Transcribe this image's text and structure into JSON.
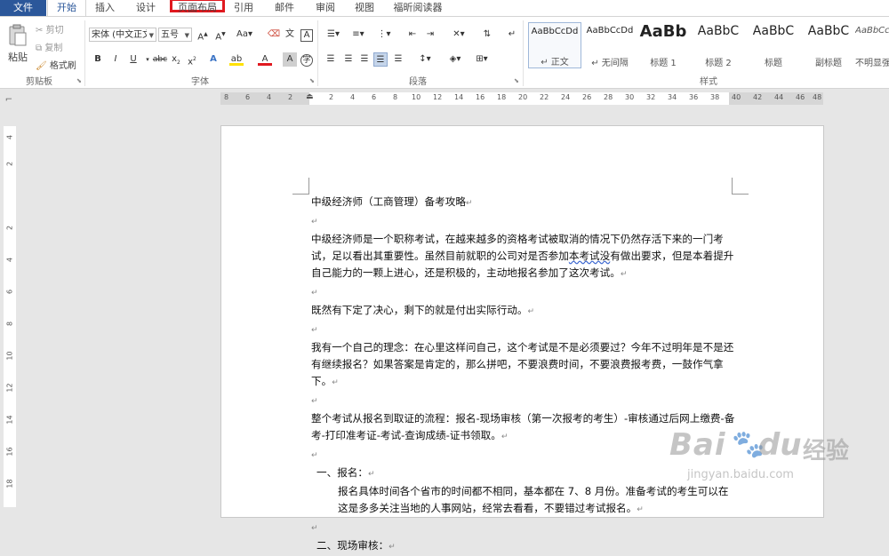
{
  "tabs": {
    "file": "文件",
    "home": "开始",
    "insert": "插入",
    "design": "设计",
    "layout": "页面布局",
    "references": "引用",
    "mailings": "邮件",
    "review": "审阅",
    "view": "视图",
    "foxit": "福昕阅读器"
  },
  "highlight_color": "#e0191f",
  "clipboard": {
    "paste": "粘贴",
    "cut": "剪切",
    "copy": "复制",
    "format_painter": "格式刷",
    "label": "剪贴板"
  },
  "font": {
    "name": "宋体 (中文正文)",
    "size": "五号",
    "label": "字体"
  },
  "paragraph": {
    "label": "段落"
  },
  "styles": {
    "label": "样式",
    "items": [
      {
        "sample": "AaBbCcDd",
        "name": "↵ 正文"
      },
      {
        "sample": "AaBbCcDd",
        "name": "↵ 无间隔"
      },
      {
        "sample": "AaBb",
        "name": "标题 1"
      },
      {
        "sample": "AaBbC",
        "name": "标题 2"
      },
      {
        "sample": "AaBbC",
        "name": "标题"
      },
      {
        "sample": "AaBbC",
        "name": "副标题"
      },
      {
        "sample": "AaBbCcDd",
        "name": "不明显强"
      }
    ]
  },
  "ruler": {
    "h_ticks": [
      "8",
      "6",
      "4",
      "2",
      "2",
      "4",
      "6",
      "8",
      "10",
      "12",
      "14",
      "16",
      "18",
      "20",
      "22",
      "24",
      "26",
      "28",
      "30",
      "32",
      "34",
      "36",
      "38",
      "40",
      "42",
      "44",
      "46",
      "48"
    ],
    "v_ticks": [
      "4",
      "2",
      "2",
      "4",
      "6",
      "8",
      "10",
      "12",
      "14",
      "16",
      "18"
    ]
  },
  "document": {
    "title": "中级经济师（工商管理）备考攻略",
    "p1": "中级经济师是一个职称考试，在越来越多的资格考试被取消的情况下仍然存活下来的一门考试，足以看出其重要性。虽然目前就职的公司对是否参加",
    "p1_wavy": "本考试没",
    "p1_end": "有做出要求，但是本着提升自己能力的一颗上进心，还是积极的，主动地报名参加了这次考试。",
    "p2": "既然有下定了决心，剩下的就是付出实际行动。",
    "p3": "我有一个自己的理念：在心里这样问自己，这个考试是不是必须要过？今年不过明年是不是还有继续报名？如果答案是肯定的，那么拼吧，不要浪费时间，不要浪费报考费，一鼓作气拿下。",
    "p4": "整个考试从报名到取证的流程：报名-现场审核（第一次报考的考生）-审核通过后网上缴费-备考-打印准考证-考试-查询成绩-证书领取。",
    "s1_heading": "一、报名：",
    "s1_body": "报名具体时间各个省市的时间都不相同，基本都在 7、8 月份。准备考试的考生可以在这是多多关注当地的人事网站，经常去看看，不要错过考试报名。",
    "s2_heading": "二、现场审核："
  },
  "watermark": {
    "brand": "Bai",
    "brand_cn": "经验",
    "url": "jingyan.baidu.com"
  }
}
